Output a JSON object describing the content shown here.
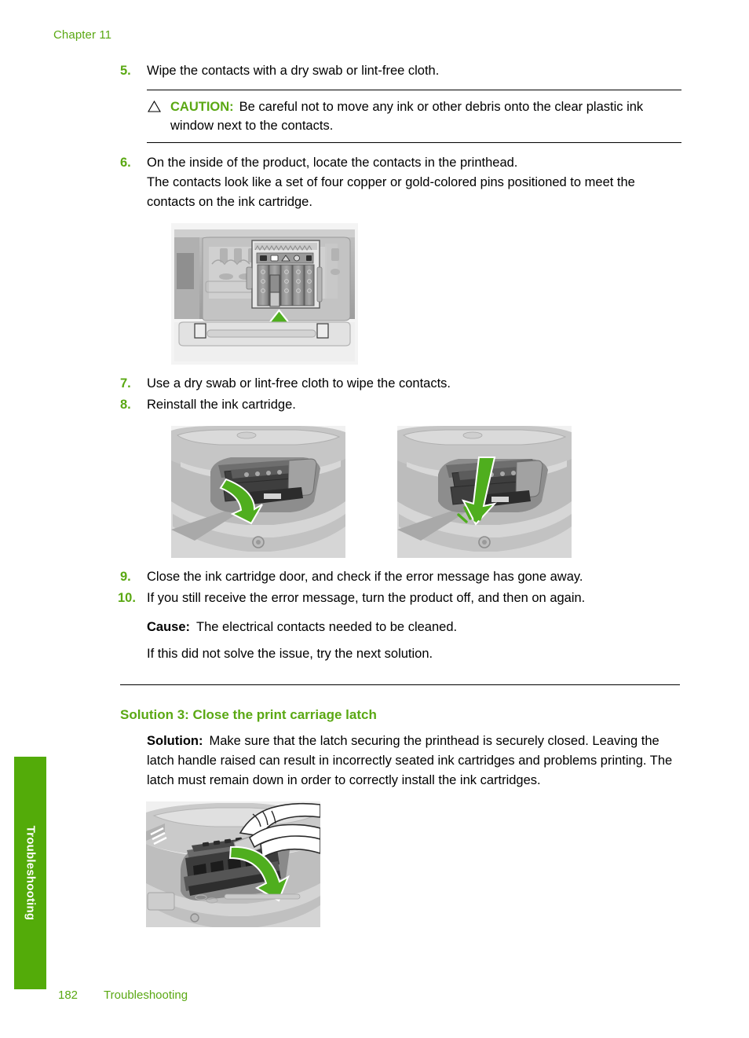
{
  "page": {
    "chapter": "Chapter 11",
    "footer_page_number": "182",
    "footer_section": "Troubleshooting",
    "side_tab_label": "Troubleshooting",
    "accent_green": "#5aa813",
    "tab_green": "#53ab09"
  },
  "steps": [
    {
      "number": "5.",
      "text": "Wipe the contacts with a dry swab or lint-free cloth."
    },
    {
      "number": "6.",
      "text": "On the inside of the product, locate the contacts in the printhead.",
      "sub": "The contacts look like a set of four copper or gold-colored pins positioned to meet the contacts on the ink cartridge."
    },
    {
      "number": "7.",
      "text": "Use a dry swab or lint-free cloth to wipe the contacts."
    },
    {
      "number": "8.",
      "text": "Reinstall the ink cartridge."
    },
    {
      "number": "9.",
      "text": "Close the ink cartridge door, and check if the error message has gone away."
    },
    {
      "number": "10.",
      "text": "If you still receive the error message, turn the product off, and then on again."
    }
  ],
  "caution": {
    "icon": "warning-triangle-icon",
    "label": "CAUTION:",
    "text": "Be careful not to move any ink or other debris onto the clear plastic ink window next to the contacts."
  },
  "cause": {
    "label": "Cause:",
    "text": "The electrical contacts needed to be cleaned."
  },
  "next_solution_note": "If this did not solve the issue, try the next solution.",
  "solution3": {
    "heading": "Solution 3: Close the print carriage latch",
    "label": "Solution:",
    "text": "Make sure that the latch securing the printhead is securely closed. Leaving the latch handle raised can result in incorrectly seated ink cartridges and problems printing. The latch must remain down in order to correctly install the ink cartridges."
  },
  "figures": [
    {
      "name": "printhead-contacts-illustration",
      "caption_arrow": "green-up-arrow"
    },
    {
      "name": "ink-cartridge-tilt-illustration",
      "caption_arrow": "green-curved-arrow"
    },
    {
      "name": "ink-cartridge-seat-illustration",
      "caption_arrow": "green-down-arrow"
    },
    {
      "name": "close-carriage-latch-illustration",
      "caption_arrow": "green-curved-down-arrow"
    }
  ]
}
